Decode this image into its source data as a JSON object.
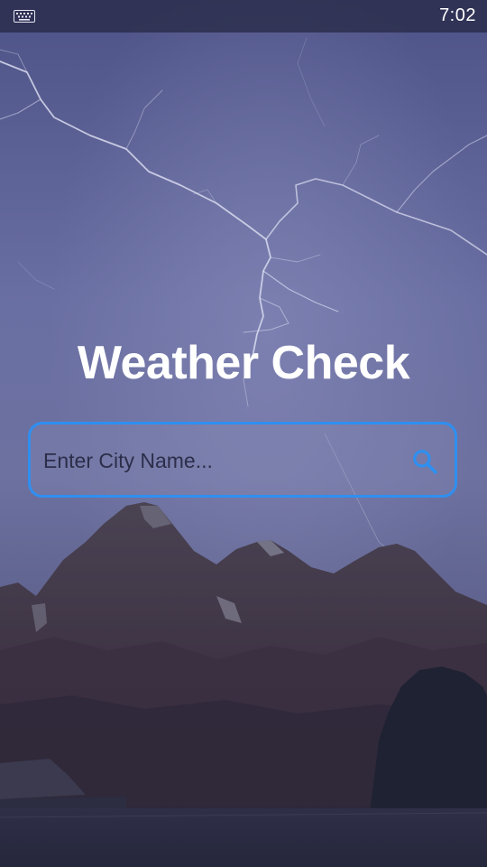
{
  "status_bar": {
    "time": "7:02",
    "keyboard_icon": "keyboard-icon"
  },
  "app": {
    "title": "Weather Check"
  },
  "search": {
    "placeholder": "Enter City Name...",
    "value": "",
    "icon": "search-icon"
  },
  "colors": {
    "accent": "#2f8ff0",
    "title_text": "#ffffff",
    "sky": "#5a6199"
  },
  "background": {
    "scene": "storm-lightning-mountains-icon"
  }
}
